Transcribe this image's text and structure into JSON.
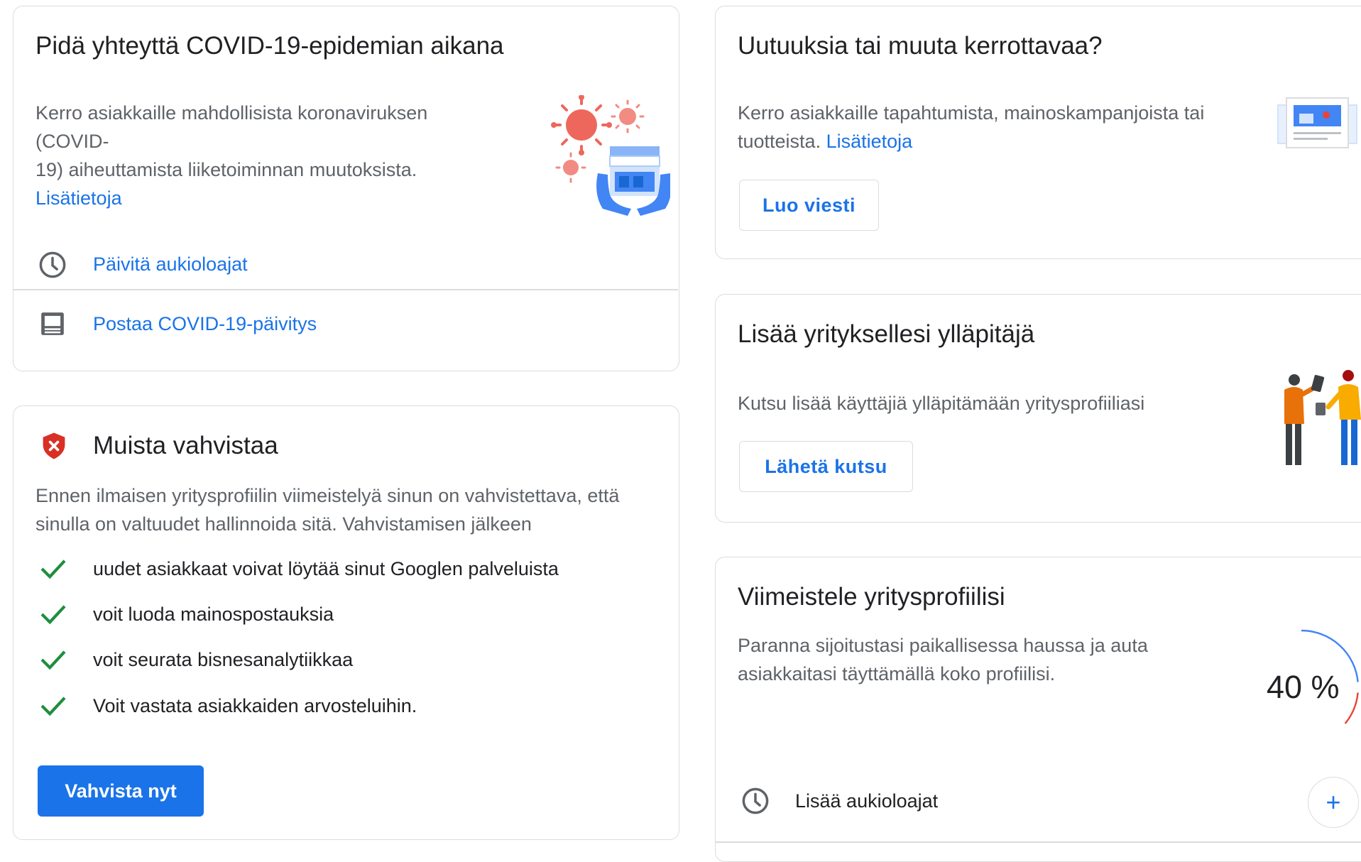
{
  "covid_card": {
    "title": "Pidä yhteyttä COVID-19-epidemian aikana",
    "desc_line1": "Kerro asiakkaille mahdollisista koronaviruksen (COVID-",
    "desc_line2": "19) aiheuttamista liiketoiminnan muutoksista.",
    "learn_more": "Lisätietoja",
    "actions": [
      {
        "label": "Päivitä aukioloajat",
        "icon": "clock-icon"
      },
      {
        "label": "Postaa COVID-19-päivitys",
        "icon": "post-icon"
      }
    ]
  },
  "verify_card": {
    "title": "Muista vahvistaa",
    "icon": "shield-alert-icon",
    "desc_line1": "Ennen ilmaisen yritysprofiilin viimeistelyä sinun on vahvistettava, että",
    "desc_line2": "sinulla on valtuudet hallinnoida sitä. Vahvistamisen jälkeen",
    "benefits": [
      "uudet asiakkaat voivat löytää sinut Googlen palveluista",
      "voit luoda mainospostauksia",
      "voit seurata bisnesanalytiikkaa",
      "Voit vastata asiakkaiden arvosteluihin."
    ],
    "button": "Vahvista nyt"
  },
  "news_card": {
    "title": "Uutuuksia tai muuta kerrottavaa?",
    "desc_line1": "Kerro asiakkaille tapahtumista, mainoskampanjoista tai",
    "desc_line2": "tuotteista.",
    "learn_more": "Lisätietoja",
    "button": "Luo viesti"
  },
  "admin_card": {
    "title": "Lisää yrityksellesi ylläpitäjä",
    "desc": "Kutsu lisää käyttäjiä ylläpitämään yritysprofiiliasi",
    "button": "Lähetä kutsu"
  },
  "profile_card": {
    "title": "Viimeistele yritysprofiilisi",
    "desc_line1": "Paranna sijoitustasi paikallisessa haussa ja auta",
    "desc_line2": "asiakkaitasi täyttämällä koko profiilisi.",
    "progress_label": "40 %",
    "progress_fraction": 0.4,
    "task": "Lisää aukioloajat",
    "add_symbol": "+"
  },
  "colors": {
    "accent": "#1a73e8",
    "success": "#1e8e3e",
    "danger": "#d93025",
    "text": "#202124",
    "muted": "#5f6368",
    "border": "#dadce0"
  }
}
